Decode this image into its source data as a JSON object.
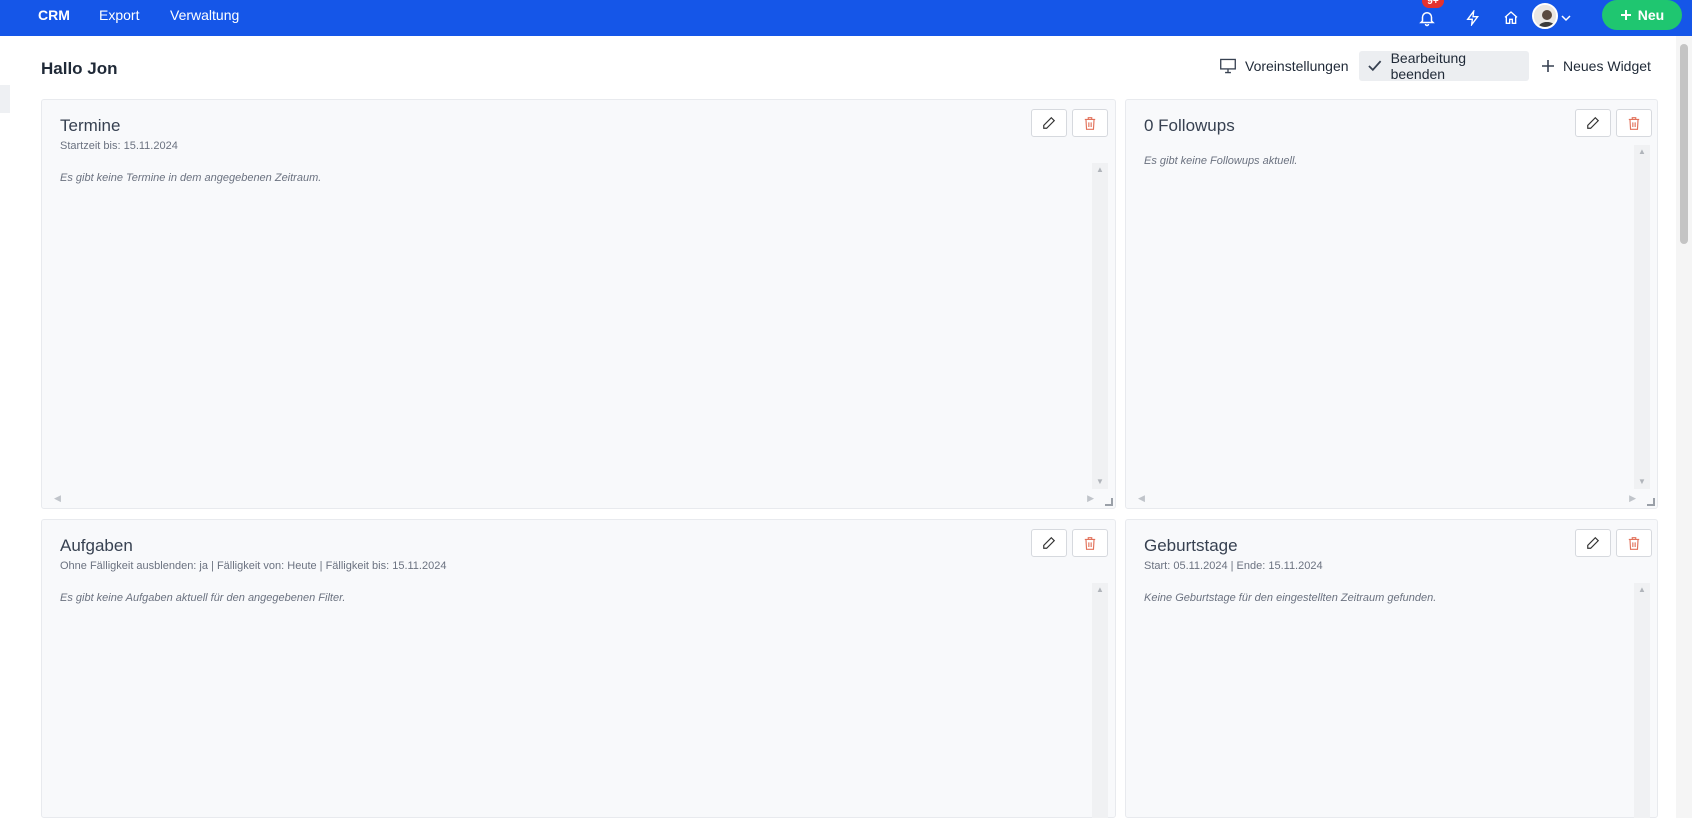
{
  "nav": {
    "brand": "CRM",
    "items": [
      "Export",
      "Verwaltung"
    ],
    "notification_badge": "9+",
    "new_button": "Neu",
    "colors": {
      "bar": "#1556e8",
      "new_button": "#1fc670",
      "badge": "#e5322d"
    }
  },
  "header": {
    "greeting": "Hallo Jon",
    "presets_label": "Voreinstellungen",
    "finish_edit_label": "Bearbeitung beenden",
    "new_widget_label": "Neues Widget"
  },
  "widgets": {
    "termine": {
      "title": "Termine",
      "subtitle": "Startzeit bis: 15.11.2024",
      "empty": "Es gibt keine Termine in dem angegebenen Zeitraum."
    },
    "followups": {
      "title": "0 Followups",
      "empty": "Es gibt keine Followups aktuell."
    },
    "aufgaben": {
      "title": "Aufgaben",
      "subtitle": "Ohne Fälligkeit ausblenden: ja | Fälligkeit von: Heute | Fälligkeit bis: 15.11.2024",
      "empty": "Es gibt keine Aufgaben aktuell für den angegebenen Filter."
    },
    "geburtstage": {
      "title": "Geburtstage",
      "subtitle": "Start: 05.11.2024 | Ende: 15.11.2024",
      "empty": "Keine Geburtstage für den eingestellten Zeitraum gefunden."
    }
  }
}
